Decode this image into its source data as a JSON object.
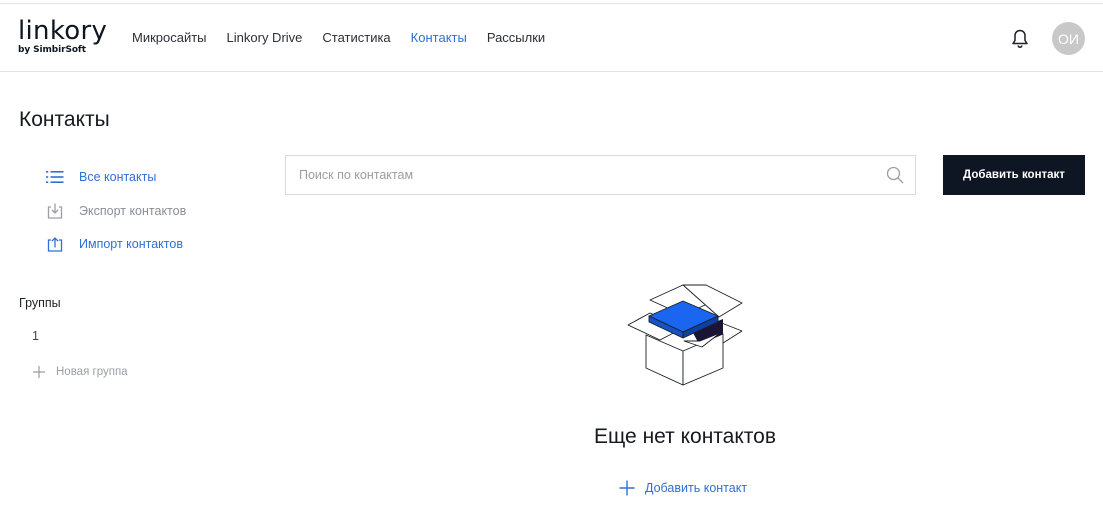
{
  "logo": {
    "main": "linkory",
    "sub": "by SimbirSoft"
  },
  "nav": {
    "items": [
      {
        "label": "Микросайты"
      },
      {
        "label": "Linkory Drive"
      },
      {
        "label": "Статистика"
      },
      {
        "label": "Контакты",
        "active": true
      },
      {
        "label": "Рассылки"
      }
    ]
  },
  "user": {
    "initials": "ОИ",
    "notifications_icon": "bell-icon"
  },
  "page": {
    "title": "Контакты"
  },
  "sidebar": {
    "items": [
      {
        "label": "Все контакты",
        "icon": "list-icon"
      },
      {
        "label": "Экспорт контактов",
        "icon": "export-icon"
      },
      {
        "label": "Импорт контактов",
        "icon": "import-icon"
      }
    ],
    "groups_title": "Группы",
    "groups": [
      "1"
    ],
    "new_group_label": "Новая группа"
  },
  "search": {
    "placeholder": "Поиск по контактам",
    "value": ""
  },
  "toolbar": {
    "add_contact_label": "Добавить контакт"
  },
  "empty_state": {
    "title": "Еще нет контактов",
    "add_label": "Добавить контакт",
    "illustration": "open-box-illustration"
  },
  "colors": {
    "accent": "#2f6fd6",
    "dark": "#0d1622",
    "box_blue": "#1a66f0",
    "avatar_bg": "#c8c8c8"
  }
}
